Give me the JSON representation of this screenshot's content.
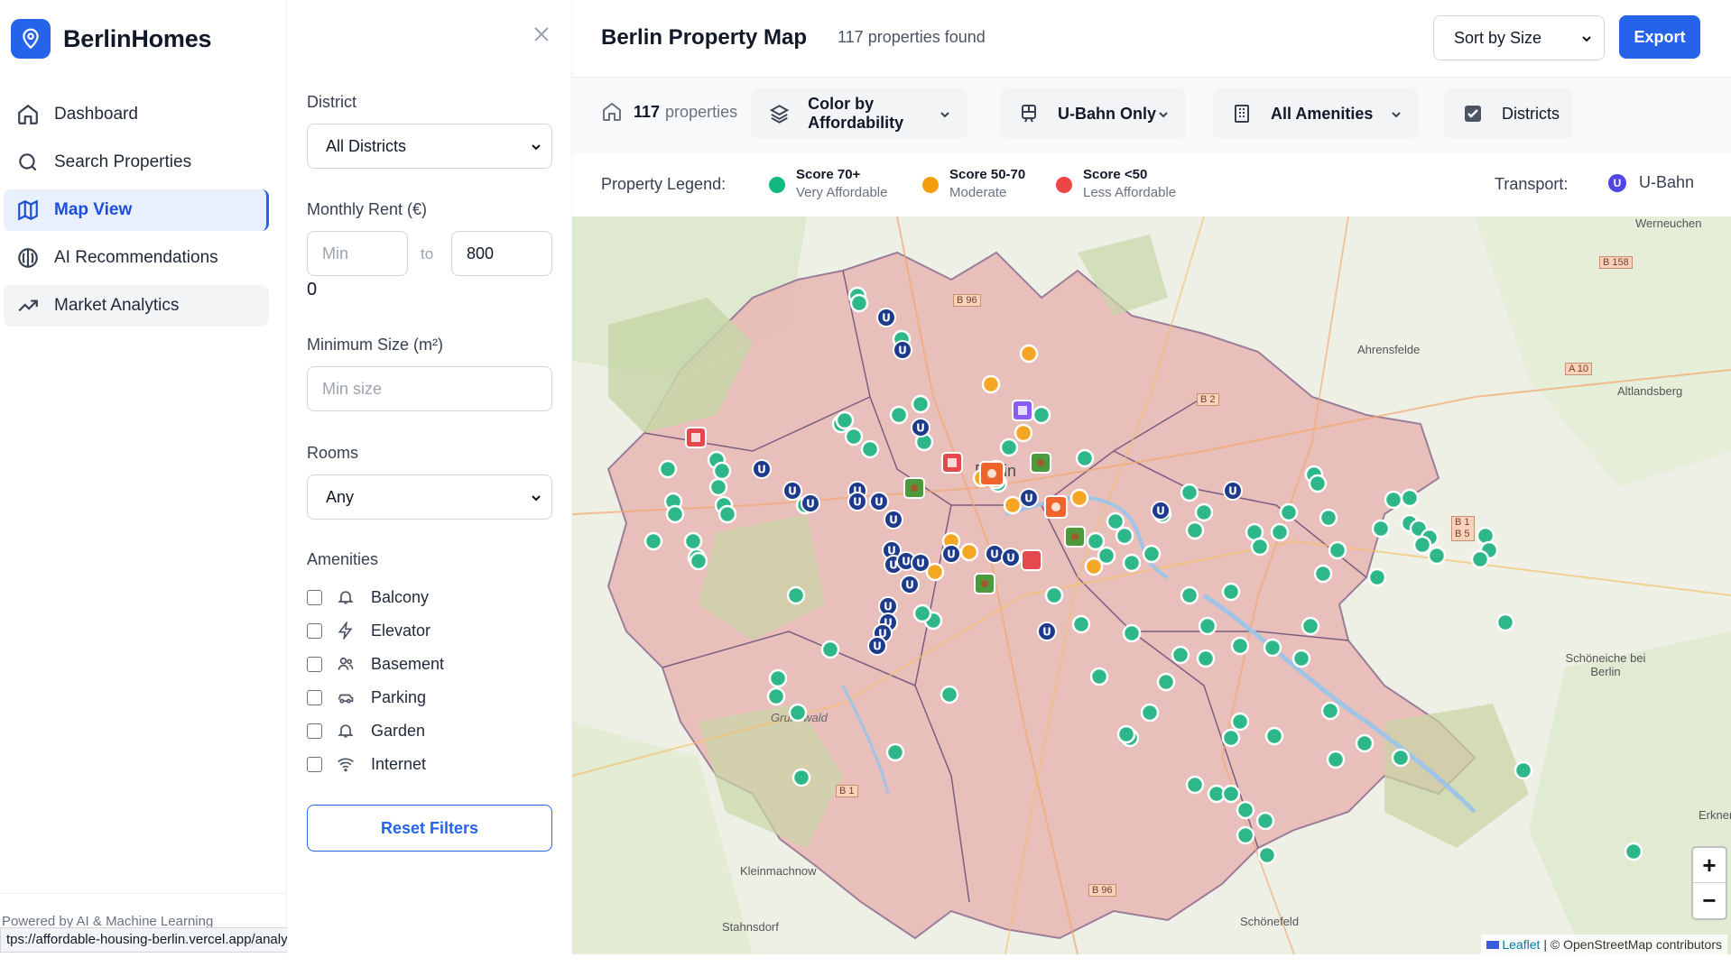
{
  "brand": {
    "name": "BerlinHomes"
  },
  "nav": {
    "items": [
      {
        "label": "Dashboard",
        "icon": "home-icon"
      },
      {
        "label": "Search Properties",
        "icon": "search-icon"
      },
      {
        "label": "Map View",
        "icon": "map-icon",
        "active": true
      },
      {
        "label": "AI Recommendations",
        "icon": "brain-icon"
      },
      {
        "label": "Market Analytics",
        "icon": "trending-up-icon"
      }
    ]
  },
  "footer": {
    "powered_by": "Powered by AI & Machine Learning",
    "status_url": "tps://affordable-housing-berlin.vercel.app/analytics"
  },
  "filters": {
    "district_label": "District",
    "district_value": "All Districts",
    "rent_label": "Monthly Rent (€)",
    "rent_min_placeholder": "Min",
    "rent_to": "to",
    "rent_max_value": "800",
    "rent_slider_value": "0",
    "size_label": "Minimum Size (m²)",
    "size_placeholder": "Min size",
    "rooms_label": "Rooms",
    "rooms_value": "Any",
    "amenities_label": "Amenities",
    "amenities": [
      {
        "label": "Balcony",
        "icon": "bell-icon"
      },
      {
        "label": "Elevator",
        "icon": "zap-icon"
      },
      {
        "label": "Basement",
        "icon": "users-icon"
      },
      {
        "label": "Parking",
        "icon": "car-icon"
      },
      {
        "label": "Garden",
        "icon": "bell-icon"
      },
      {
        "label": "Internet",
        "icon": "wifi-icon"
      }
    ],
    "reset_label": "Reset Filters"
  },
  "header": {
    "title": "Berlin Property Map",
    "found": "117 properties found",
    "sort_value": "Sort by Size",
    "export_label": "Export"
  },
  "toolbar": {
    "count": "117",
    "count_suffix": "properties",
    "color_by": "Color by Affordability",
    "transport_filter": "U-Bahn Only",
    "amenities_filter": "All Amenities",
    "districts_toggle": "Districts"
  },
  "legend": {
    "title": "Property Legend:",
    "items": [
      {
        "score": "Score 70+",
        "desc": "Very Affordable",
        "color": "#10b981"
      },
      {
        "score": "Score 50-70",
        "desc": "Moderate",
        "color": "#f59e0b"
      },
      {
        "score": "Score <50",
        "desc": "Less Affordable",
        "color": "#ef4444"
      }
    ],
    "transport_label": "Transport:",
    "transport_item": "U-Bahn",
    "ubahn_color": "#4f46e5"
  },
  "map": {
    "place_labels": [
      "Berlin",
      "Ahrensfelde",
      "Altlandsberg",
      "Werneuchen",
      "Schöneiche bei Berlin",
      "Kleinmachnow",
      "Stahnsdorf",
      "Schönefeld",
      "Grunewald",
      "Erkner"
    ],
    "road_labels": [
      "B 96",
      "B 158",
      "A 10",
      "B 2",
      "B 1 B 5",
      "B 96",
      "B 1"
    ],
    "attribution_leaflet": "Leaflet",
    "attribution_osm": "| © OpenStreetMap contributors",
    "zoom_in": "+",
    "zoom_out": "−"
  }
}
